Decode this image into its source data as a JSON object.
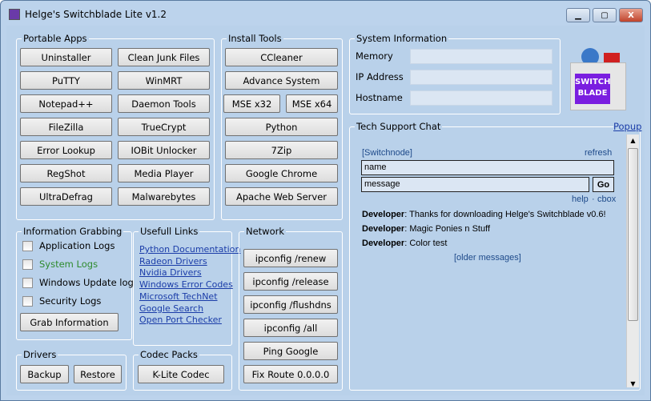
{
  "window": {
    "title": "Helge's Switchblade Lite v1.2",
    "minimize": "▁",
    "maximize": "▢",
    "close": "X"
  },
  "portable_apps": {
    "title": "Portable Apps",
    "buttons": [
      "Uninstaller",
      "Clean Junk Files",
      "PuTTY",
      "WinMRT",
      "Notepad++",
      "Daemon Tools",
      "FileZilla",
      "TrueCrypt",
      "Error Lookup",
      "IOBit Unlocker",
      "RegShot",
      "Media Player",
      "UltraDefrag",
      "Malwarebytes"
    ]
  },
  "install_tools": {
    "title": "Install Tools",
    "ccleaner": "CCleaner",
    "advance": "Advance System",
    "mse32": "MSE x32",
    "mse64": "MSE x64",
    "python": "Python",
    "zip": "7Zip",
    "chrome": "Google Chrome",
    "apache": "Apache Web Server"
  },
  "system_info": {
    "title": "System Information",
    "memory": "Memory",
    "ip": "IP Address",
    "hostname": "Hostname",
    "memory_value": "",
    "ip_value": "",
    "hostname_value": ""
  },
  "logo": {
    "text": "SWITCH BLADE"
  },
  "chat": {
    "title": "Tech Support Chat",
    "popup": "Popup",
    "channel": "[Switchnode]",
    "refresh": "refresh",
    "name_value": "name",
    "message_value": "message",
    "go": "Go",
    "help": "help",
    "sep": "·",
    "cbox": "cbox",
    "messages": [
      {
        "user": "Developer",
        "text": ": Thanks for downloading Helge's Switchblade v0.6!"
      },
      {
        "user": "Developer",
        "text": ": Magic Ponies n Stuff"
      },
      {
        "user": "Developer",
        "text": ": Color test"
      }
    ],
    "older": "[older messages]"
  },
  "info_grabbing": {
    "title": "Information Grabbing",
    "items": [
      "Application Logs",
      "System Logs",
      "Windows Update log",
      "Security Logs"
    ],
    "highlight_color": "#2e8b2e",
    "grab": "Grab Information"
  },
  "links": {
    "title": "Usefull Links",
    "items": [
      "Python Documentation",
      "Radeon Drivers",
      "Nvidia Drivers",
      "Windows Error Codes",
      "Microsoft TechNet",
      "Google Search",
      "Open Port Checker"
    ]
  },
  "network": {
    "title": "Network",
    "buttons": [
      "ipconfig /renew",
      "ipconfig /release",
      "ipconfig /flushdns",
      "ipconfig /all",
      "Ping Google",
      "Fix Route 0.0.0.0"
    ]
  },
  "drivers": {
    "title": "Drivers",
    "backup": "Backup",
    "restore": "Restore"
  },
  "codec": {
    "title": "Codec Packs",
    "klite": "K-Lite Codec"
  }
}
